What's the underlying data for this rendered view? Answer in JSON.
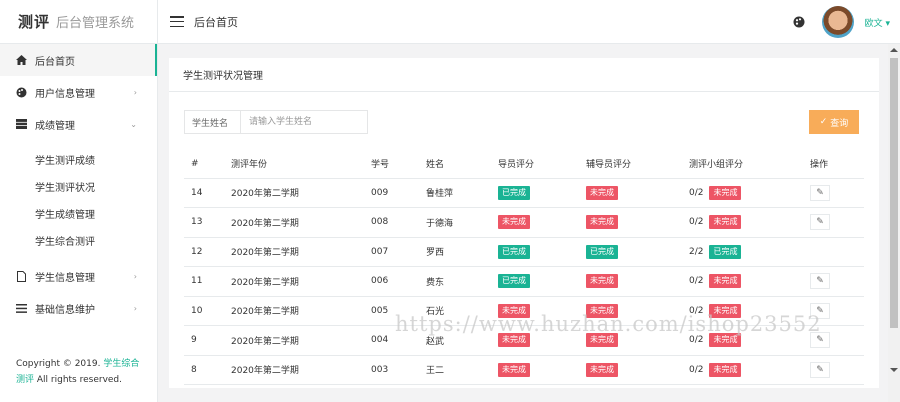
{
  "app": {
    "logo_strong": "测评",
    "logo_light": "后台管理系统"
  },
  "topbar": {
    "page_title": "后台首页",
    "user_name": "欧文 ▾",
    "icons": [
      "menu-icon",
      "palette-icon"
    ]
  },
  "sidebar": {
    "items": [
      {
        "label": "后台首页",
        "icon": "home-icon"
      },
      {
        "label": "用户信息管理",
        "icon": "palette-icon"
      },
      {
        "label": "成绩管理",
        "icon": "list-icon"
      },
      {
        "label": "学生信息管理",
        "icon": "file-icon"
      },
      {
        "label": "基础信息维护",
        "icon": "bars-icon"
      }
    ],
    "submenu": [
      "学生测评成绩",
      "学生测评状况",
      "学生成绩管理",
      "学生综合测评"
    ],
    "copyright_prefix": "Copyright © 2019.",
    "copyright_brand": "学生综合测评",
    "copyright_suffix": "All rights reserved."
  },
  "panel": {
    "title": "学生测评状况管理",
    "search_label": "学生姓名",
    "search_placeholder": "请输入学生姓名",
    "query_label": "查询"
  },
  "table": {
    "headers": [
      "#",
      "测评年份",
      "学号",
      "姓名",
      "导员评分",
      "辅导员评分",
      "测评小组评分",
      "操作"
    ],
    "rows": [
      {
        "id": "14",
        "year": "2020年第二学期",
        "sid": "009",
        "name": "鲁桂萍",
        "guide": "已完成",
        "counselor": "未完成",
        "group_score": "0/2",
        "group": "未完成",
        "op": "✎"
      },
      {
        "id": "13",
        "year": "2020年第二学期",
        "sid": "008",
        "name": "于德海",
        "guide": "未完成",
        "counselor": "未完成",
        "group_score": "0/2",
        "group": "未完成",
        "op": "✎"
      },
      {
        "id": "12",
        "year": "2020年第二学期",
        "sid": "007",
        "name": "罗西",
        "guide": "已完成",
        "counselor": "已完成",
        "group_score": "2/2",
        "group": "已完成",
        "op": ""
      },
      {
        "id": "11",
        "year": "2020年第二学期",
        "sid": "006",
        "name": "费东",
        "guide": "已完成",
        "counselor": "未完成",
        "group_score": "0/2",
        "group": "未完成",
        "op": "✎"
      },
      {
        "id": "10",
        "year": "2020年第二学期",
        "sid": "005",
        "name": "石光",
        "guide": "未完成",
        "counselor": "未完成",
        "group_score": "0/2",
        "group": "未完成",
        "op": "✎"
      },
      {
        "id": "9",
        "year": "2020年第二学期",
        "sid": "004",
        "name": "赵武",
        "guide": "未完成",
        "counselor": "未完成",
        "group_score": "0/2",
        "group": "未完成",
        "op": "✎"
      },
      {
        "id": "8",
        "year": "2020年第二学期",
        "sid": "003",
        "name": "王二",
        "guide": "未完成",
        "counselor": "未完成",
        "group_score": "0/2",
        "group": "未完成",
        "op": "✎"
      }
    ]
  },
  "watermark": "https://www.huzhan.com/ishop23552",
  "colors": {
    "accent": "#1ab394",
    "warning": "#f8ac59",
    "danger": "#ed5565"
  }
}
